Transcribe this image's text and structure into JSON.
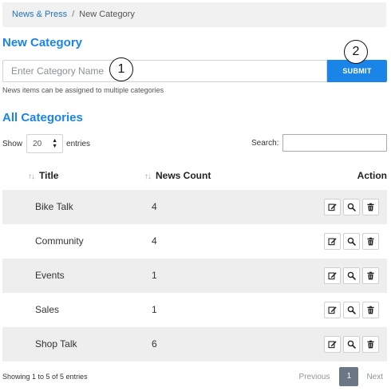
{
  "breadcrumb": {
    "parent": "News & Press",
    "separator": "/",
    "current": "New Category"
  },
  "new_category": {
    "title": "New Category",
    "input_placeholder": "Enter Category Name",
    "input_value": "",
    "submit_label": "SUBMIT",
    "help_text": "News items can be assigned to multiple categories"
  },
  "markers": {
    "one": "1",
    "two": "2"
  },
  "all_categories": {
    "title": "All Categories",
    "show_label": "Show",
    "entries_value": "20",
    "entries_label": "entries",
    "search_label": "Search:",
    "search_value": "",
    "columns": {
      "title": "Title",
      "news_count": "News Count",
      "action": "Action"
    },
    "sort_icon": "↑↓",
    "rows": [
      {
        "title": "Bike Talk",
        "count": "4"
      },
      {
        "title": "Community",
        "count": "4"
      },
      {
        "title": "Events",
        "count": "1"
      },
      {
        "title": "Sales",
        "count": "1"
      },
      {
        "title": "Shop Talk",
        "count": "6"
      }
    ],
    "action_icons": [
      "edit-icon",
      "search-icon",
      "trash-icon"
    ],
    "info_text": "Showing 1 to 5 of 5 entries",
    "pagination": {
      "previous": "Previous",
      "current": "1",
      "next": "Next"
    }
  },
  "colors": {
    "accent": "#1a85e6",
    "stripe": "#eeeeee",
    "page_active": "#6b7785"
  }
}
